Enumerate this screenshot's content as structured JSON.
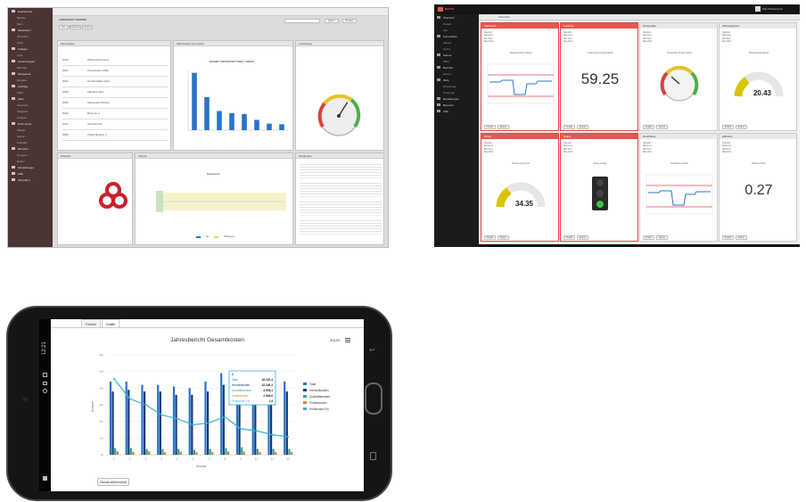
{
  "desktop": {
    "sidebar_items": [
      {
        "label": "Dashboards",
        "sub": false
      },
      {
        "label": "Module",
        "sub": true
      },
      {
        "label": "Mein",
        "sub": true
      },
      {
        "label": "Meßstellen",
        "sub": false
      },
      {
        "label": "Übersicht",
        "sub": true
      },
      {
        "label": "Karte",
        "sub": true
      },
      {
        "label": "Anlagen",
        "sub": false
      },
      {
        "label": "Liste",
        "sub": true
      },
      {
        "label": "Auswertungen",
        "sub": false
      },
      {
        "label": "Berichte",
        "sub": true
      },
      {
        "label": "Messwerte",
        "sub": false
      },
      {
        "label": "Eingabe",
        "sub": true
      },
      {
        "label": "Aufträge",
        "sub": false
      },
      {
        "label": "Offen",
        "sub": true
      },
      {
        "label": "Ziele",
        "sub": false
      },
      {
        "label": "Kennzahl",
        "sub": true
      },
      {
        "label": "Vergleich",
        "sub": true
      },
      {
        "label": "Analyse",
        "sub": true
      },
      {
        "label": "Dokumente",
        "sub": false
      },
      {
        "label": "Ablage",
        "sub": true
      },
      {
        "label": "Suche",
        "sub": true
      },
      {
        "label": "Freigabe",
        "sub": true
      },
      {
        "label": "Benutzer",
        "sub": false
      },
      {
        "label": "Gruppen",
        "sub": true
      },
      {
        "label": "Rollen",
        "sub": true
      },
      {
        "label": "Einstellungen",
        "sub": false
      },
      {
        "label": "Hilfe",
        "sub": false
      },
      {
        "label": "Abmelden",
        "sub": false
      }
    ],
    "header_title": "Dashboard Standard",
    "header_buttons": [
      "Neu",
      "Bearbeiten",
      "Löschen"
    ],
    "top_right_buttons": [
      "Export",
      "Drucken"
    ],
    "panels": {
      "list_title": "Messstellen",
      "bar_title": "Messstellen Kennwerte",
      "bar_chart_title": "Anzahl Meßstellen nach Status",
      "gauge_title": "Auslastung",
      "map_title": "Standort",
      "timeline_title": "Verlauf",
      "timeline_chart_title": "Messwerte",
      "news_title": "Meldungen"
    },
    "list_rows": [
      {
        "id": "0012",
        "text": "Wasserwerk Nord"
      },
      {
        "id": "0021",
        "text": "Pumpstation Mitte"
      },
      {
        "id": "0033",
        "text": "Hochbehälter West"
      },
      {
        "id": "0045",
        "text": "Klärwerk Süd"
      },
      {
        "id": "0058",
        "text": "Messpunkt Brücke"
      },
      {
        "id": "0063",
        "text": "Brunnen 4"
      },
      {
        "id": "0071",
        "text": "Schacht Ost"
      },
      {
        "id": "0089",
        "text": "Zulauf Becken 2"
      }
    ],
    "bar_values": [
      78,
      45,
      26,
      23,
      22,
      14,
      9,
      8
    ],
    "gauge_value": 62,
    "legend": [
      "Ist",
      "Planwert"
    ]
  },
  "red_dashboard": {
    "brand": "NEXUS",
    "user": "Max Mustermann",
    "tab": "Übersicht",
    "sidebar_items": [
      {
        "label": "Übersicht",
        "sub": false
      },
      {
        "label": "Details",
        "sub": true
      },
      {
        "label": "Alle",
        "sub": true
      },
      {
        "label": "Kennzahlen",
        "sub": false
      },
      {
        "label": "Aktuell",
        "sub": true
      },
      {
        "label": "Archiv",
        "sub": true
      },
      {
        "label": "Alarme",
        "sub": false
      },
      {
        "label": "Offen",
        "sub": true
      },
      {
        "label": "Berichte",
        "sub": false
      },
      {
        "label": "Export",
        "sub": true
      },
      {
        "label": "Ziele",
        "sub": false
      },
      {
        "label": "Bewertung",
        "sub": true
      },
      {
        "label": "Prognose",
        "sub": true
      },
      {
        "label": "Einstellungen",
        "sub": false
      },
      {
        "label": "Benutzer",
        "sub": false
      },
      {
        "label": "Hilfe",
        "sub": false
      }
    ],
    "cards": [
      {
        "title": "Verbrauch",
        "alert": true,
        "kind": "line",
        "caption": "Tagesverbrauch aktuell"
      },
      {
        "title": "Leistung",
        "alert": true,
        "kind": "number",
        "caption": "Leistung Erzeugung aktuell",
        "value": "59.25"
      },
      {
        "title": "Temperatur",
        "alert": false,
        "kind": "gauge",
        "caption": "Temperatur Kessel Vorlauf"
      },
      {
        "title": "Wirkungsgrad",
        "alert": false,
        "kind": "half",
        "caption": "Wirkungsgrad aktuell",
        "value": "20.43"
      },
      {
        "title": "Druck",
        "alert": true,
        "kind": "half",
        "caption": "Druck Leitung Ost",
        "value": "34.35"
      },
      {
        "title": "Status",
        "alert": true,
        "kind": "light",
        "caption": "Status Anlage"
      },
      {
        "title": "Durchfluss",
        "alert": false,
        "kind": "line",
        "caption": "Durchfluss Verlauf"
      },
      {
        "title": "Effizienz",
        "alert": false,
        "kind": "number",
        "caption": "Effizienz Index",
        "value": "0.27"
      }
    ],
    "card_fields": [
      "Standort",
      "Messung",
      "Min Wert",
      "Max Wert"
    ],
    "card_buttons": [
      "Details",
      "Export"
    ]
  },
  "phone": {
    "tabs": [
      "Tabelle",
      "Grafik"
    ],
    "active_tab": 1,
    "zoom_label": "Zoom",
    "bottom_button": "Gesamtübersicht",
    "status_time": "12:21",
    "chart_data": {
      "type": "bar",
      "title": "Jahresbericht Gesamtkosten",
      "xlabel": "Monat",
      "ylabel": "Kosten",
      "categories": [
        "1",
        "2",
        "3",
        "4",
        "5",
        "6",
        "7",
        "8",
        "9",
        "10",
        "11",
        "12"
      ],
      "ylim": [
        0,
        60000
      ],
      "series": [
        {
          "name": "Total",
          "values": [
            44000,
            44000,
            42000,
            42000,
            41000,
            40000,
            44000,
            49000,
            50000,
            44000,
            44000,
            44000
          ]
        },
        {
          "name": "Herstellkosten",
          "values": [
            38000,
            39000,
            38000,
            38000,
            36000,
            36000,
            38000,
            42000,
            43000,
            38000,
            39000,
            38000
          ]
        },
        {
          "name": "Qualitätskosten",
          "values": [
            4000,
            4000,
            3500,
            3500,
            3500,
            3000,
            3500,
            4000,
            4500,
            3500,
            3500,
            3500
          ]
        },
        {
          "name": "Fehlerkosten",
          "values": [
            2000,
            1800,
            2000,
            1500,
            1800,
            1500,
            1600,
            2000,
            2000,
            1700,
            1600,
            1600
          ]
        },
        {
          "name": "Fehlerrate (%)",
          "values": [
            3.8,
            2.8,
            2.5,
            2.0,
            1.8,
            1.5,
            1.6,
            1.9,
            1.3,
            1.2,
            1.0,
            0.9
          ]
        }
      ],
      "y2lim": [
        0,
        5
      ],
      "tooltip": {
        "header": "8",
        "rows": [
          [
            "Total",
            "49.220,4"
          ],
          [
            "Herstellkosten",
            "42.246,3"
          ],
          [
            "Qualitätskosten",
            "4.906,1"
          ],
          [
            "Fehlerkosten",
            "2.068,0"
          ],
          [
            "Fehlerrate (%)",
            "1,9"
          ]
        ]
      }
    }
  },
  "colors": {
    "accent_red": "#e9564f",
    "bar_blue": "#2a73c9",
    "dark_blue": "#123b6e",
    "teal": "#2aa6a0",
    "orange": "#e07b1f",
    "gauge_yellow": "#d9c400"
  }
}
